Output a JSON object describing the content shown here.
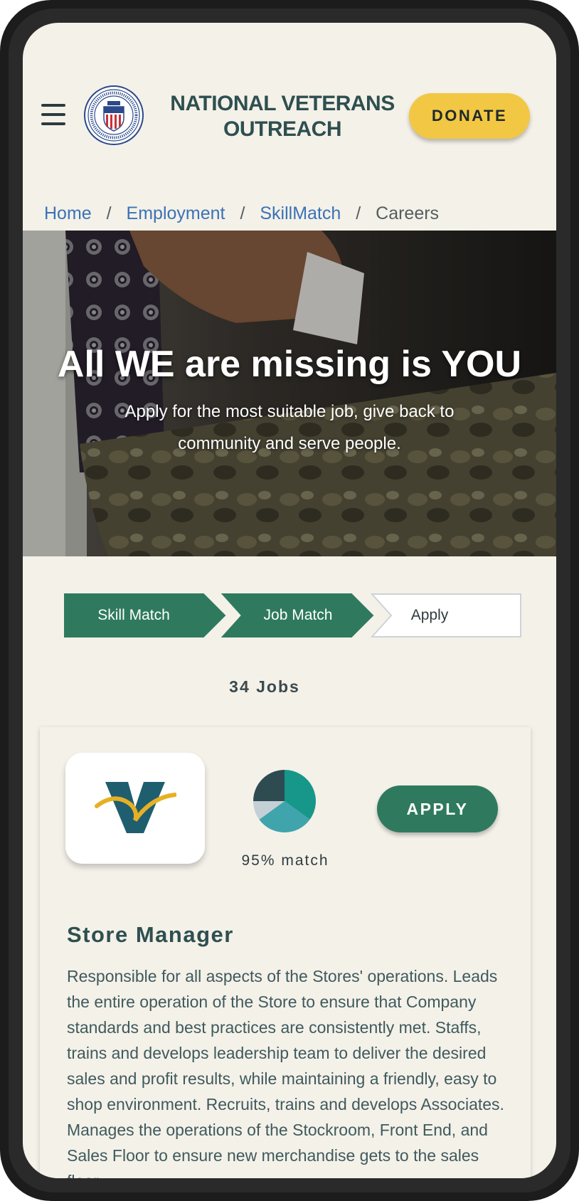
{
  "header": {
    "org_name": "NATIONAL VETERANS OUTREACH",
    "donate_label": "DONATE"
  },
  "breadcrumb": {
    "items": [
      "Home",
      "Employment",
      "SkillMatch"
    ],
    "current": "Careers",
    "separator": "/"
  },
  "hero": {
    "title": "All WE are missing is YOU",
    "subtitle": "Apply for the most suitable job, give back to community and serve people."
  },
  "steps": [
    {
      "label": "Skill Match",
      "state": "completed"
    },
    {
      "label": "Job Match",
      "state": "completed"
    },
    {
      "label": "Apply",
      "state": "current"
    }
  ],
  "jobs": {
    "count_label": "34 Jobs",
    "card": {
      "match_label": "95% match",
      "match_pie": [
        {
          "share": 0.35,
          "color": "#169789"
        },
        {
          "share": 0.3,
          "color": "#3fa4ac"
        },
        {
          "share": 0.1,
          "color": "#c5cfd6"
        },
        {
          "share": 0.25,
          "color": "#2e4b52"
        }
      ],
      "apply_label": "APPLY",
      "title": "Store Manager",
      "description": "Responsible for all aspects of the Stores' operations. Leads the entire operation of the Store to ensure that Company standards and best practices are consistently met. Staffs, trains and develops leadership team to deliver the desired sales and profit results, while maintaining a friendly, easy to shop environment. Recruits, trains and develops Associates. Manages the operations of the Stockroom, Front End, and Sales Floor to ensure new merchandise gets to the sales floor."
    }
  },
  "colors": {
    "page_bg": "#f4f1e9",
    "brand_text": "#2e4f4f",
    "donate": "#f2c744",
    "primary_green": "#2f7a5e",
    "link_blue": "#3b72b5"
  }
}
